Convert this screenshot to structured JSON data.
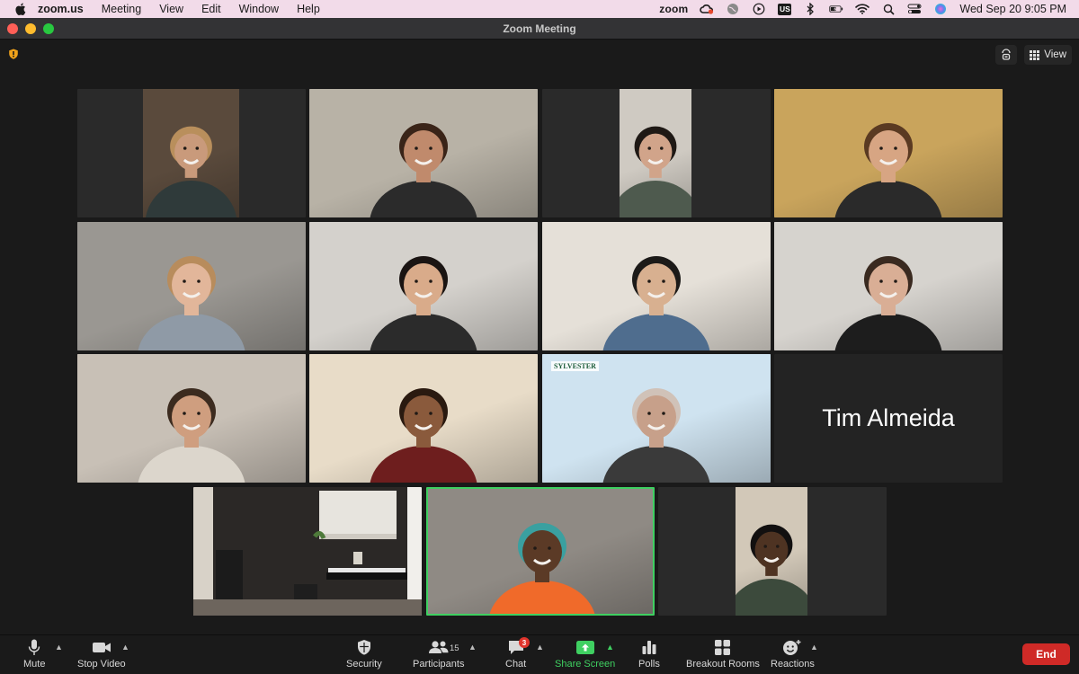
{
  "menubar": {
    "app_name": "zoom.us",
    "menus": [
      "Meeting",
      "View",
      "Edit",
      "Window",
      "Help"
    ],
    "status_app": "zoom",
    "input_source": "US",
    "clock": "Wed Sep 20  9:05 PM"
  },
  "window": {
    "title": "Zoom Meeting"
  },
  "meeting_controls": {
    "view_label": "View"
  },
  "participants_grid": [
    {
      "type": "video",
      "bg": "#2a2a2a",
      "video_bg": "#5a4a3c",
      "skin": "#c99a7b",
      "hair": "#b98f5c",
      "shirt": "#2f3a3a"
    },
    {
      "type": "video",
      "bg": "#2a2a2a",
      "video_bg": "#b8b2a6",
      "skin": "#c08a6c",
      "hair": "#3a2418",
      "shirt": "#2b2b2b"
    },
    {
      "type": "video",
      "bg": "#2a2a2a",
      "video_bg": "#cfcac2",
      "skin": "#d1a48a",
      "hair": "#1f1915",
      "shirt": "#4e5a4e"
    },
    {
      "type": "video",
      "bg": "#2a2a2a",
      "video_bg": "#c9a45c",
      "skin": "#d7a583",
      "hair": "#5a3a22",
      "shirt": "#2a2a2a"
    },
    {
      "type": "video",
      "bg": "#2a2a2a",
      "video_bg": "#9a9792",
      "skin": "#e2b69a",
      "hair": "#b88c5c",
      "shirt": "#8f9aa6"
    },
    {
      "type": "video",
      "bg": "#2a2a2a",
      "video_bg": "#d4d1cc",
      "skin": "#d9ab8a",
      "hair": "#1a1412",
      "shirt": "#2b2b2b"
    },
    {
      "type": "video",
      "bg": "#2a2a2a",
      "video_bg": "#e5e0d8",
      "skin": "#d8b090",
      "hair": "#1c1a18",
      "shirt": "#4f6d8e"
    },
    {
      "type": "video",
      "bg": "#2a2a2a",
      "video_bg": "#d6d3ce",
      "skin": "#d9ae95",
      "hair": "#3a2a20",
      "shirt": "#1d1d1d"
    },
    {
      "type": "video",
      "bg": "#2a2a2a",
      "video_bg": "#c8c0b6",
      "skin": "#cf9e7f",
      "hair": "#3c2b1f",
      "shirt": "#dcd6cc"
    },
    {
      "type": "video",
      "bg": "#2a2a2a",
      "video_bg": "#e8dcc8",
      "skin": "#8a5a3c",
      "hair": "#2a1a10",
      "shirt": "#6e1e1e"
    },
    {
      "type": "video",
      "bg": "#2a2a2a",
      "video_bg": "#cfe3f0",
      "skin": "#c7a08a",
      "hair": "#d0c2b8",
      "shirt": "#3a3a3a",
      "logo": "SYLVESTER"
    },
    {
      "type": "name",
      "name": "Tim Almeida"
    },
    {
      "type": "video",
      "bg": "#2a2a2a",
      "video_bg": "#2e2b28",
      "skin": "#000000",
      "hair": "#000000",
      "shirt": "#000000"
    },
    {
      "type": "video",
      "bg": "#2a2a2a",
      "video_bg": "#8f8a84",
      "skin": "#5b3a26",
      "hair": "#3aa0a0",
      "shirt": "#f06a2a",
      "active": true
    },
    {
      "type": "video",
      "bg": "#2a2a2a",
      "video_bg": "#d2c8b8",
      "skin": "#4e3322",
      "hair": "#121010",
      "shirt": "#3c4a3c"
    }
  ],
  "toolbar": {
    "mute": "Mute",
    "stop_video": "Stop Video",
    "security": "Security",
    "participants": "Participants",
    "participants_count": "15",
    "chat": "Chat",
    "chat_unread": "3",
    "share_screen": "Share Screen",
    "polls": "Polls",
    "breakout_rooms": "Breakout Rooms",
    "reactions": "Reactions",
    "end": "End"
  },
  "colors": {
    "active_speaker": "#3fd061",
    "end_button": "#cf2a27",
    "share_green": "#3fd061",
    "menubar_bg": "#f2dbe9"
  }
}
